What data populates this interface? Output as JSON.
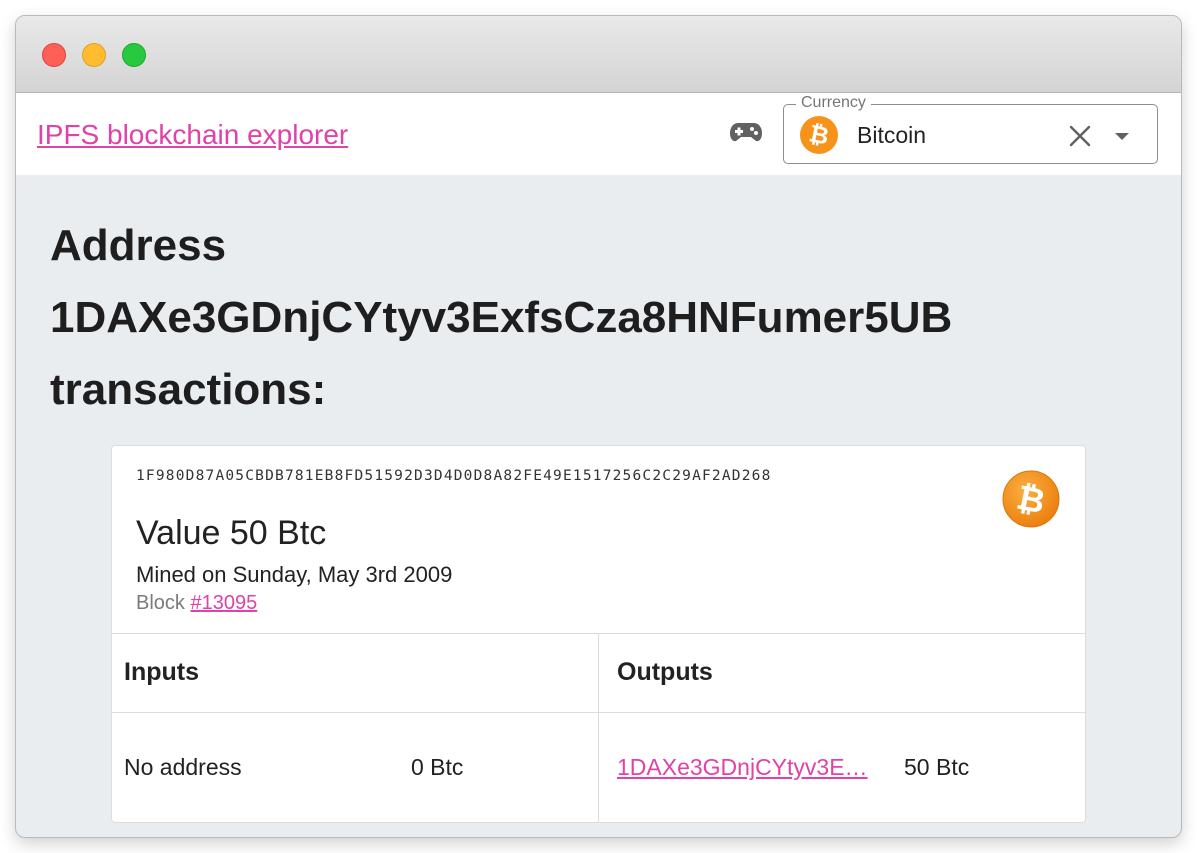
{
  "appbar": {
    "brand": "IPFS blockchain explorer",
    "currency": {
      "legend": "Currency",
      "value": "Bitcoin",
      "icon": "bitcoin-icon"
    }
  },
  "page": {
    "heading_line1": "Address",
    "heading_line2": "1DAXe3GDnjCYtyv3ExfsCza8HNFumer5UB",
    "heading_line3": "transactions:"
  },
  "transaction": {
    "hash": "1F980D87A05CBDB781EB8FD51592D3D4D0D8A82FE49E1517256C2C29AF2AD268",
    "value": "Value 50 Btc",
    "mined": "Mined on Sunday, May 3rd 2009",
    "block_label": "Block",
    "block_link": "#13095",
    "inputs_header": "Inputs",
    "outputs_header": "Outputs",
    "inputs": [
      {
        "address": "No address",
        "value": "0 Btc"
      }
    ],
    "outputs": [
      {
        "address": "1DAXe3GDnjCYtyv3E…",
        "value": "50 Btc"
      }
    ]
  },
  "colors": {
    "accent": "#e042a8",
    "bitcoin": "#f7931a",
    "background": "#eaedf0"
  }
}
